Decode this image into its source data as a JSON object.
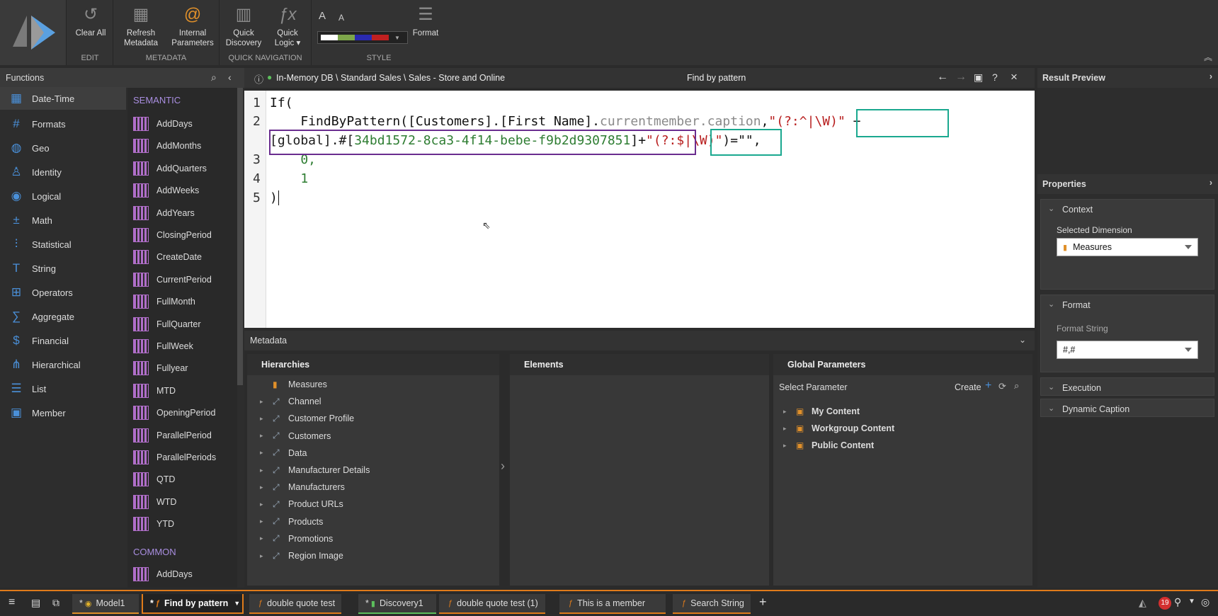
{
  "ribbon": {
    "edit": {
      "clear_all": "Clear All",
      "group": "EDIT"
    },
    "metadata": {
      "refresh_line1": "Refresh",
      "refresh_line2": "Metadata",
      "internal_line1": "Internal",
      "internal_line2": "Parameters",
      "group": "METADATA"
    },
    "quick_nav": {
      "discovery_line1": "Quick",
      "discovery_line2": "Discovery",
      "logic_line1": "Quick",
      "logic_line2": "Logic ▾",
      "group": "QUICK NAVIGATION"
    },
    "style": {
      "format": "Format",
      "group": "STYLE",
      "font_up": "A",
      "font_down": "A",
      "palette": [
        "#ffffff",
        "#7da64a",
        "#2a2ab0",
        "#c02020"
      ]
    }
  },
  "functions": {
    "title": "Functions",
    "categories": [
      {
        "label": "Date-Time",
        "icon": "calendar-icon"
      },
      {
        "label": "Formats",
        "icon": "format-icon"
      },
      {
        "label": "Geo",
        "icon": "globe-icon"
      },
      {
        "label": "Identity",
        "icon": "person-icon"
      },
      {
        "label": "Logical",
        "icon": "logical-icon"
      },
      {
        "label": "Math",
        "icon": "math-icon"
      },
      {
        "label": "Statistical",
        "icon": "statistical-icon"
      },
      {
        "label": "String",
        "icon": "string-icon"
      },
      {
        "label": "Operators",
        "icon": "operators-icon"
      },
      {
        "label": "Aggregate",
        "icon": "sigma-icon"
      },
      {
        "label": "Financial",
        "icon": "dollar-icon"
      },
      {
        "label": "Hierarchical",
        "icon": "hierarchy-icon"
      },
      {
        "label": "List",
        "icon": "list-icon"
      },
      {
        "label": "Member",
        "icon": "member-icon"
      }
    ],
    "semantic_label": "SEMANTIC",
    "semantic_items": [
      "AddDays",
      "AddMonths",
      "AddQuarters",
      "AddWeeks",
      "AddYears",
      "ClosingPeriod",
      "CreateDate",
      "CurrentPeriod",
      "FullMonth",
      "FullQuarter",
      "FullWeek",
      "Fullyear",
      "MTD",
      "OpeningPeriod",
      "ParallelPeriod",
      "ParallelPeriods",
      "QTD",
      "WTD",
      "YTD"
    ],
    "common_label": "COMMON",
    "common_items": [
      "AddDays"
    ]
  },
  "editor": {
    "breadcrumb": "In-Memory DB \\ Standard Sales \\ Sales - Store and Online",
    "title": "Find by pattern",
    "lines": {
      "l1": "If(",
      "l2_a": "    FindByPattern([Customers].[First Name].",
      "l2_b": "currentmember.caption",
      "l2_c": ",",
      "l2_d": "\"(?:^|\\W)\"",
      "l2_e": " +",
      "l2b_a": "[global].#[",
      "l2b_b": "34bd1572-8ca3-4f14-bebe-f9b2d9307851",
      "l2b_c": "]",
      "l2b_d": "+",
      "l2b_e": "\"(?:$|\\W)\"",
      "l2b_f": ")=\"\",",
      "l3": "    0,",
      "l4": "    1",
      "l5": ")"
    },
    "line_numbers": [
      "1",
      "2",
      "3",
      "4",
      "5"
    ]
  },
  "metadata": {
    "title": "Metadata",
    "hierarchies_title": "Hierarchies",
    "hierarchies": [
      "Measures",
      "Channel",
      "Customer Profile",
      "Customers",
      "Data",
      "Manufacturer Details",
      "Manufacturers",
      "Product URLs",
      "Products",
      "Promotions",
      "Region Image"
    ],
    "elements_title": "Elements",
    "global_title": "Global Parameters",
    "select_parameter": "Select Parameter",
    "create": "Create",
    "global_items": [
      "My Content",
      "Workgroup Content",
      "Public Content"
    ]
  },
  "right_panel": {
    "result_preview": "Result Preview",
    "properties": "Properties",
    "context": "Context",
    "selected_dimension_label": "Selected Dimension",
    "selected_dimension": "Measures",
    "format": "Format",
    "format_string_label": "Format String",
    "format_string": "#,#",
    "execution": "Execution",
    "dynamic_caption": "Dynamic Caption"
  },
  "taskbar": {
    "tabs": [
      {
        "label": "Model1",
        "prefix": "*"
      },
      {
        "label": "Find by pattern",
        "prefix": "*"
      },
      {
        "label": "double quote test",
        "prefix": ""
      },
      {
        "label": "Discovery1",
        "prefix": "*"
      },
      {
        "label": "double quote test (1)",
        "prefix": ""
      },
      {
        "label": "This is a member",
        "prefix": ""
      },
      {
        "label": "Search String",
        "prefix": ""
      }
    ],
    "notifications": "19"
  }
}
